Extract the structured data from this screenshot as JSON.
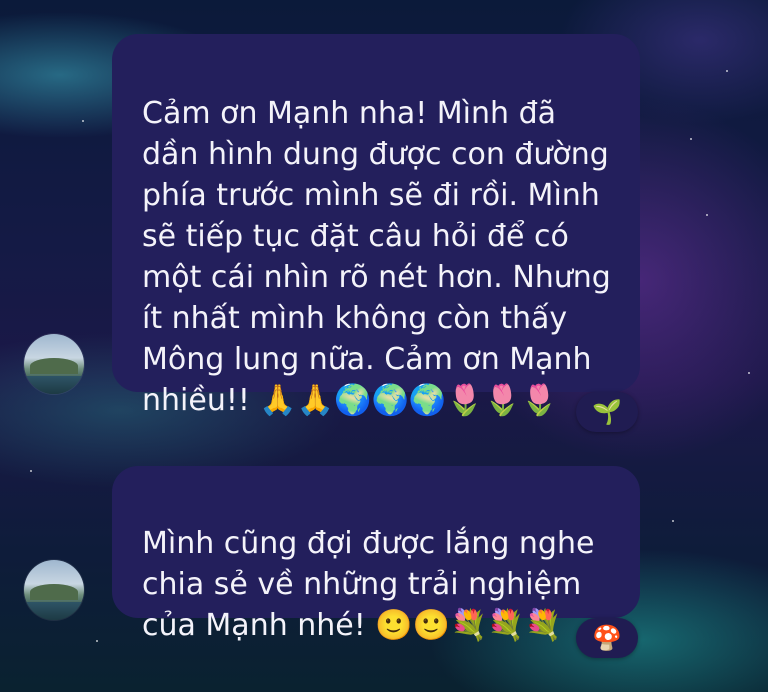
{
  "messages": [
    {
      "text": "Cảm ơn Mạnh nha! Mình đã\ndần hình dung được con đường\nphía trước mình sẽ đi rồi. Mình\nsẽ tiếp tục đặt câu hỏi để có\nmột cái nhìn rõ nét hơn. Nhưng\nít nhất mình không còn thấy\nMông lung nữa. Cảm ơn Mạnh\nnhiều!! 🙏🙏🌍🌍🌍🌷🌷🌷",
      "reaction": "🌱"
    },
    {
      "text": "Mình cũng đợi được lắng nghe\nchia sẻ về những trải nghiệm\ncủa Mạnh nhé! 🙂🙂💐💐💐",
      "reaction": "🍄"
    }
  ],
  "colors": {
    "bubble": "#231f5c",
    "text": "#f4f3fa",
    "reaction_pill": "#201c52"
  }
}
